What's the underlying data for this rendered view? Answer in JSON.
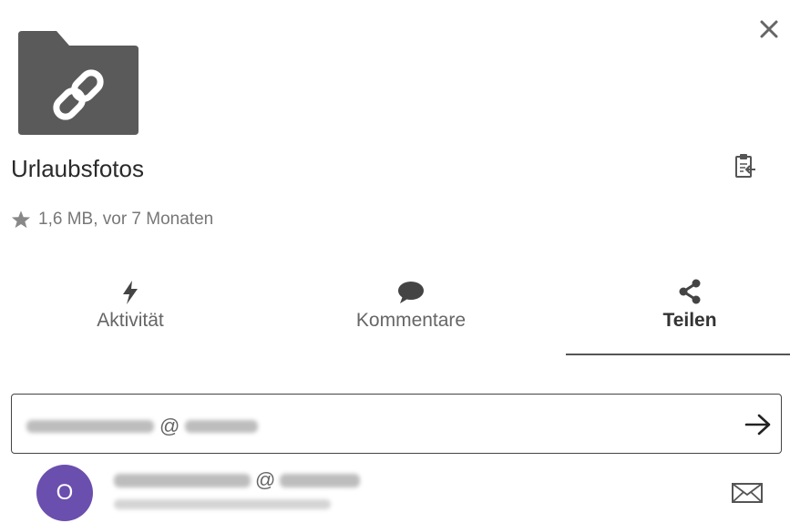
{
  "file": {
    "name": "Urlaubsfotos",
    "meta": "1,6 MB, vor 7 Monaten",
    "icon": "shared-link-folder-icon"
  },
  "tabs": [
    {
      "label": "Aktivität",
      "icon": "bolt-icon"
    },
    {
      "label": "Kommentare",
      "icon": "comment-icon"
    },
    {
      "label": "Teilen",
      "icon": "share-icon",
      "active": true
    }
  ],
  "share": {
    "input_at": "@",
    "suggestion_avatar_letter": "O",
    "suggestion_at": "@"
  },
  "colors": {
    "avatar": "#6a4fae",
    "folder": "#5a5a5a",
    "active_tab_underline": "#555555"
  }
}
